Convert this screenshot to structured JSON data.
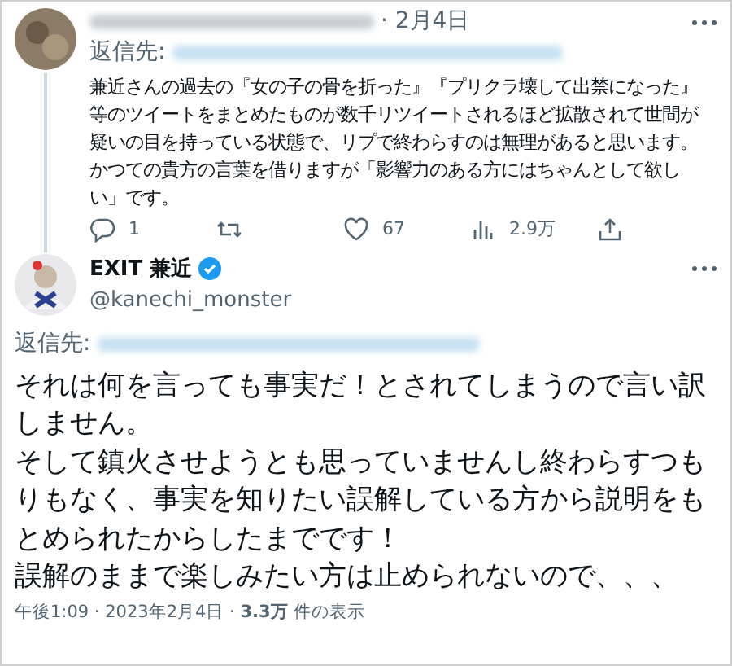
{
  "reply_tweet": {
    "date": "· 2月4日",
    "reply_to_label": "返信先:",
    "text": "兼近さんの過去の『女の子の骨を折った』『プリクラ壊して出禁になった』等のツイートをまとめたものが数千リツイートされるほど拡散されて世間が疑いの目を持っている状態で、リプで終わらすのは無理があると思います。かつての貴方の言葉を借りますが「影響力のある方にはちゃんとして欲しい」です。",
    "actions": [
      {
        "kind": "reply",
        "count": "1"
      },
      {
        "kind": "retweet"
      },
      {
        "kind": "like",
        "count": "67"
      },
      {
        "kind": "views",
        "count": "2.9万"
      },
      {
        "kind": "share"
      }
    ]
  },
  "main_tweet": {
    "display_name": "EXIT 兼近",
    "verified": true,
    "handle": "@kanechi_monster",
    "reply_to_label": "返信先:",
    "paragraphs": [
      "それは何を言っても事実だ！とされてしまうので言い訳しません。",
      "そして鎮火させようとも思っていませんし終わらすつもりもなく、事実を知りたい誤解している方から説明をもとめられたからしたまでです！",
      "誤解のままで楽しみたい方は止められないので、、、"
    ],
    "footer": "午後1:09 · 2023年2月4日 · **3.3万** 件の表示"
  }
}
